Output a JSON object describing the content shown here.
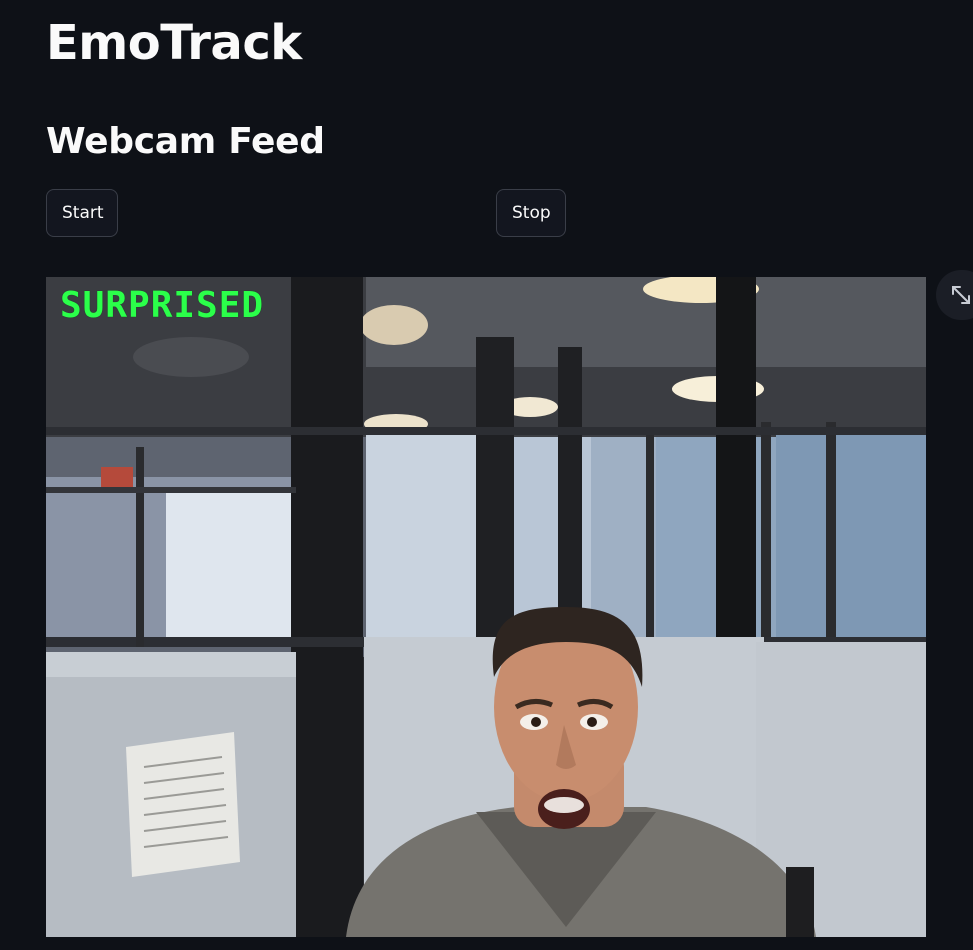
{
  "app": {
    "title": "EmoTrack"
  },
  "section": {
    "title": "Webcam Feed"
  },
  "controls": {
    "start_label": "Start",
    "stop_label": "Stop"
  },
  "webcam": {
    "detected_emotion": "SURPRISED",
    "emotion_label_color": "#2bff4a"
  },
  "icons": {
    "fullscreen": "expand-diagonal-arrows"
  },
  "theme": {
    "background": "#0e1117",
    "text": "#fafafa",
    "button_border": "#3a3e48"
  }
}
